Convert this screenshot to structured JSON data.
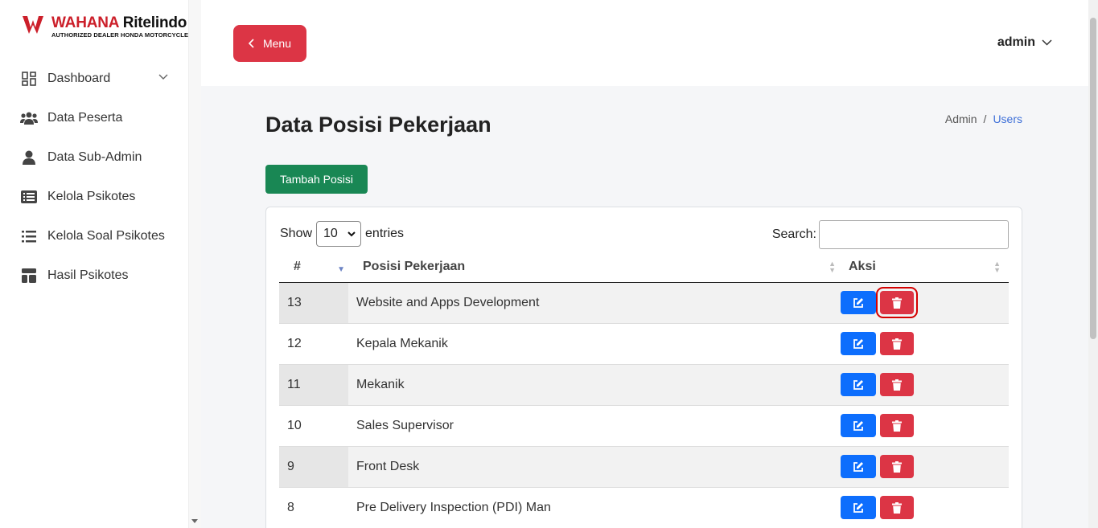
{
  "brand": {
    "name_part1": "WAHANA",
    "name_part2": "Ritelindo",
    "tagline": "AUTHORIZED DEALER HONDA MOTORCYCLE"
  },
  "sidebar": {
    "items": [
      {
        "label": "Dashboard",
        "icon": "dashboard-grid-icon"
      },
      {
        "label": "Data Peserta",
        "icon": "users-icon"
      },
      {
        "label": "Data Sub-Admin",
        "icon": "user-icon"
      },
      {
        "label": "Kelola Psikotes",
        "icon": "list-alt-icon"
      },
      {
        "label": "Kelola Soal Psikotes",
        "icon": "list-icon"
      },
      {
        "label": "Hasil Psikotes",
        "icon": "layout-icon"
      }
    ]
  },
  "topbar": {
    "menu_label": "Menu",
    "user_label": "admin"
  },
  "page": {
    "title": "Data Posisi Pekerjaan",
    "breadcrumb": [
      "Admin",
      "Users"
    ],
    "add_button": "Tambah Posisi"
  },
  "table_controls": {
    "show_label": "Show",
    "entries_value": "10",
    "entries_label": "entries",
    "search_label": "Search:"
  },
  "table": {
    "columns": [
      "#",
      "Posisi Pekerjaan",
      "Aksi"
    ],
    "rows": [
      {
        "num": "13",
        "posisi": "Website and Apps Development"
      },
      {
        "num": "12",
        "posisi": "Kepala Mekanik"
      },
      {
        "num": "11",
        "posisi": "Mekanik"
      },
      {
        "num": "10",
        "posisi": "Sales Supervisor"
      },
      {
        "num": "9",
        "posisi": "Front Desk"
      },
      {
        "num": "8",
        "posisi": "Pre Delivery Inspection (PDI) Man"
      }
    ]
  },
  "colors": {
    "danger": "#dc3545",
    "primary": "#0d6efd",
    "success": "#198754",
    "brand_red": "#cc1f2a"
  }
}
